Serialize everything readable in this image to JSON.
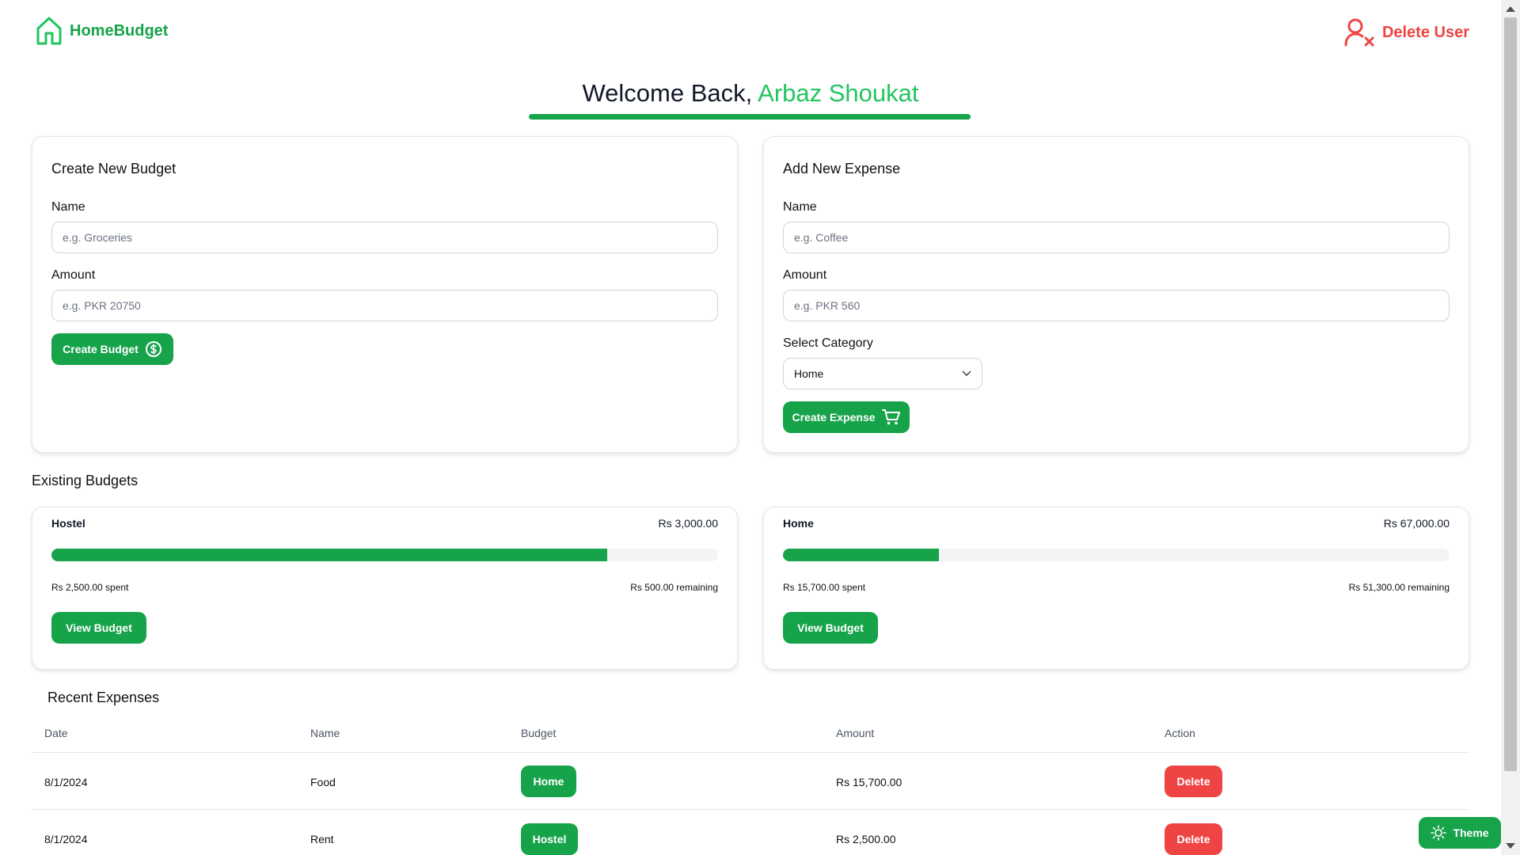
{
  "header": {
    "brand": "HomeBudget",
    "delete_user": "Delete User"
  },
  "welcome": {
    "prefix": "Welcome Back,",
    "user_name": "Arbaz Shoukat"
  },
  "create_budget": {
    "title": "Create New Budget",
    "name_label": "Name",
    "name_placeholder": "e.g. Groceries",
    "amount_label": "Amount",
    "amount_placeholder": "e.g. PKR 20750",
    "button": "Create Budget"
  },
  "add_expense": {
    "title": "Add New Expense",
    "name_label": "Name",
    "name_placeholder": "e.g. Coffee",
    "amount_label": "Amount",
    "amount_placeholder": "e.g. PKR 560",
    "category_label": "Select Category",
    "category_selected": "Home",
    "button": "Create Expense"
  },
  "existing_budgets": {
    "title": "Existing Budgets",
    "budgets": [
      {
        "name": "Hostel",
        "total": "Rs 3,000.00",
        "spent": "Rs 2,500.00 spent",
        "remaining": "Rs 500.00 remaining",
        "progress": 0.8333,
        "button": "View Budget"
      },
      {
        "name": "Home",
        "total": "Rs 67,000.00",
        "spent": "Rs 15,700.00 spent",
        "remaining": "Rs 51,300.00 remaining",
        "progress": 0.2343,
        "button": "View Budget"
      }
    ]
  },
  "recent_expenses": {
    "title": "Recent Expenses",
    "columns": [
      "Date",
      "Name",
      "Budget",
      "Amount",
      "Action"
    ],
    "rows": [
      {
        "date": "8/1/2024",
        "name": "Food",
        "budget": "Home",
        "amount": "Rs 15,700.00",
        "action": "Delete"
      },
      {
        "date": "8/1/2024",
        "name": "Rent",
        "budget": "Hostel",
        "amount": "Rs 2,500.00",
        "action": "Delete"
      }
    ]
  },
  "theme_button": "Theme",
  "colors": {
    "accent": "#16a34a",
    "accent_light": "#22c55e",
    "danger": "#ef4444"
  },
  "icons": {
    "brand": "house-icon",
    "delete_user": "user-x-icon",
    "create_budget": "dollar-circle-icon",
    "create_expense": "cart-icon",
    "select": "chevron-down-icon",
    "theme": "sun-icon"
  }
}
